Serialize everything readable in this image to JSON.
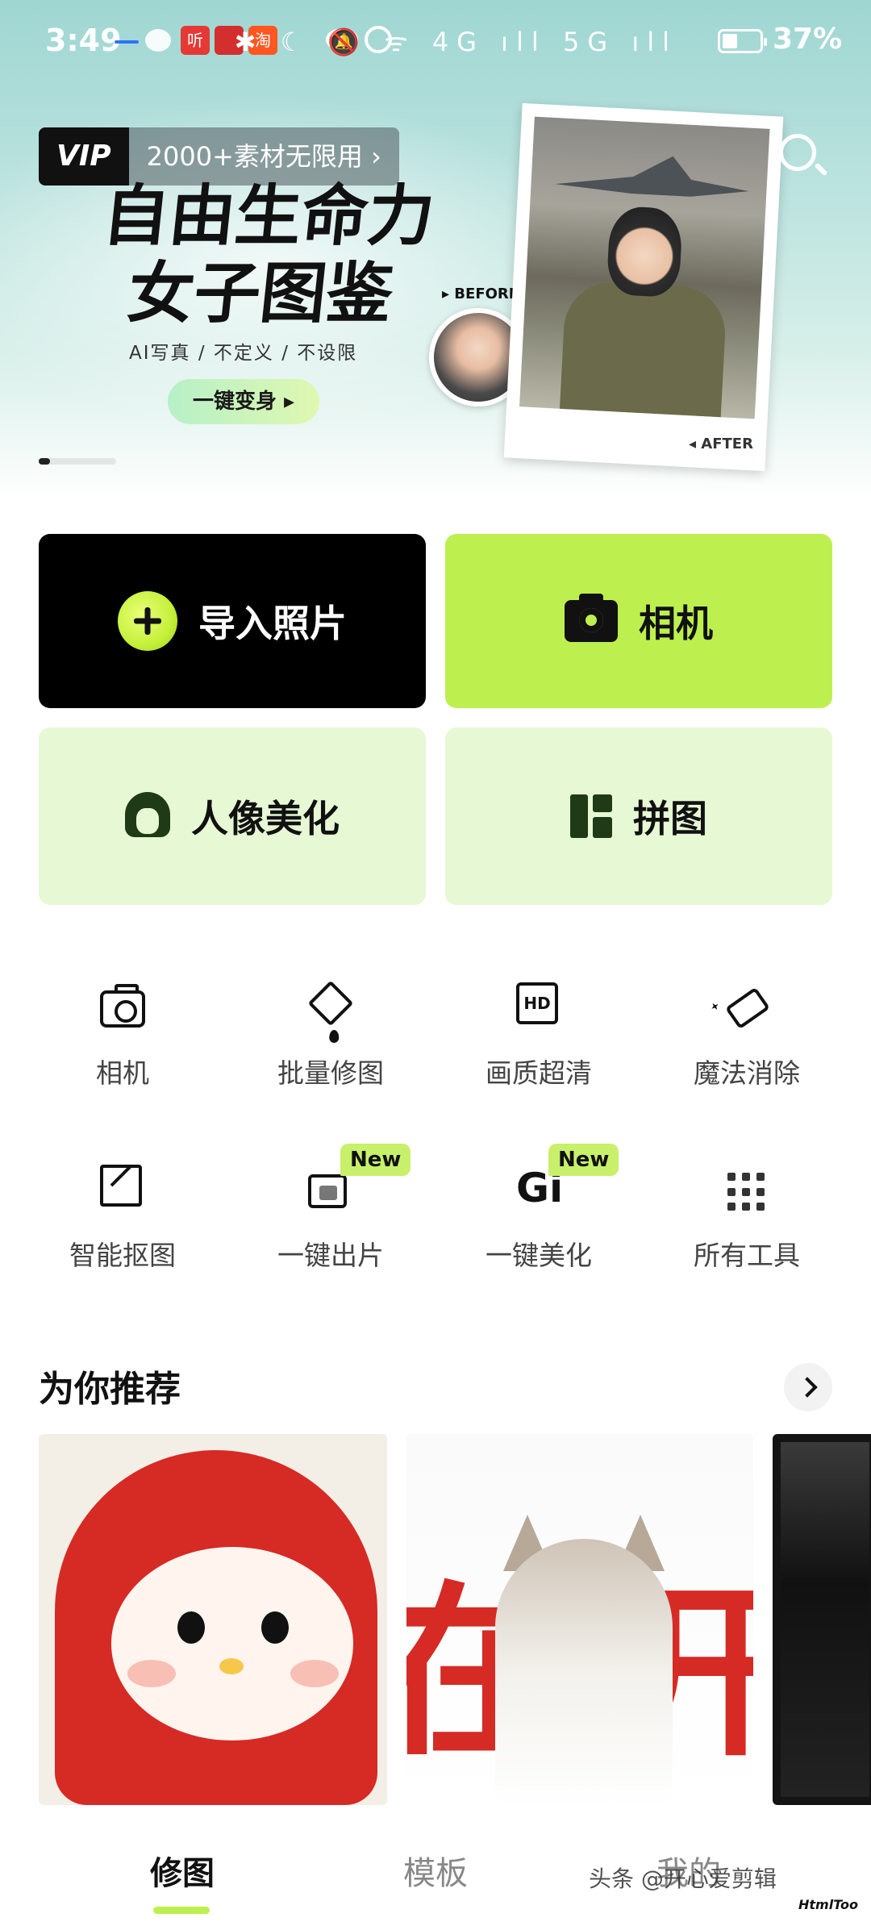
{
  "status_bar": {
    "time": "3:49",
    "app_ting": "听",
    "app_taobao": "淘",
    "network_icons": "✱ ☾ 🔕 ᯤ 4G ıll 5G ıll",
    "battery_percent": "37%"
  },
  "banner": {
    "vip_badge": "VIP",
    "vip_text": "2000+素材无限用 ›",
    "title_line1": "自由生命力",
    "title_line2": "女子图鉴",
    "subtitle": "AI写真 / 不定义 / 不设限",
    "cta_label": "一键变身 ▸",
    "before_label": "▸ BEFORE",
    "after_label": "◂ AFTER",
    "carousel_position": 1
  },
  "main_actions": {
    "import_label": "导入照片",
    "camera_label": "相机",
    "portrait_label": "人像美化",
    "collage_label": "拼图"
  },
  "tools": [
    {
      "label": "相机",
      "icon": "camera-icon",
      "badge": ""
    },
    {
      "label": "批量修图",
      "icon": "batch-edit-icon",
      "badge": ""
    },
    {
      "label": "画质超清",
      "icon": "hd-icon",
      "badge": ""
    },
    {
      "label": "魔法消除",
      "icon": "magic-eraser-icon",
      "badge": ""
    },
    {
      "label": "智能抠图",
      "icon": "smart-cutout-icon",
      "badge": ""
    },
    {
      "label": "一键出片",
      "icon": "one-click-photo-icon",
      "badge": "New"
    },
    {
      "label": "一键美化",
      "icon": "one-click-beauty-icon",
      "badge": "New"
    },
    {
      "label": "所有工具",
      "icon": "all-tools-grid-icon",
      "badge": ""
    }
  ],
  "hd_icon_text": "HD",
  "beauty_icon_text": "Gi",
  "recommend": {
    "title": "为你推荐",
    "card2_chars": [
      "在",
      "开"
    ]
  },
  "bottom_nav": {
    "items": [
      {
        "label": "修图",
        "active": true
      },
      {
        "label": "模板",
        "active": false
      },
      {
        "label": "我的",
        "active": false
      }
    ]
  },
  "watermark": {
    "text": "头条 @开心爱剪辑",
    "logo": "HtmlToo"
  },
  "colors": {
    "accent_green": "#bdf04f",
    "light_green": "#e7f8d4",
    "black": "#000000"
  }
}
